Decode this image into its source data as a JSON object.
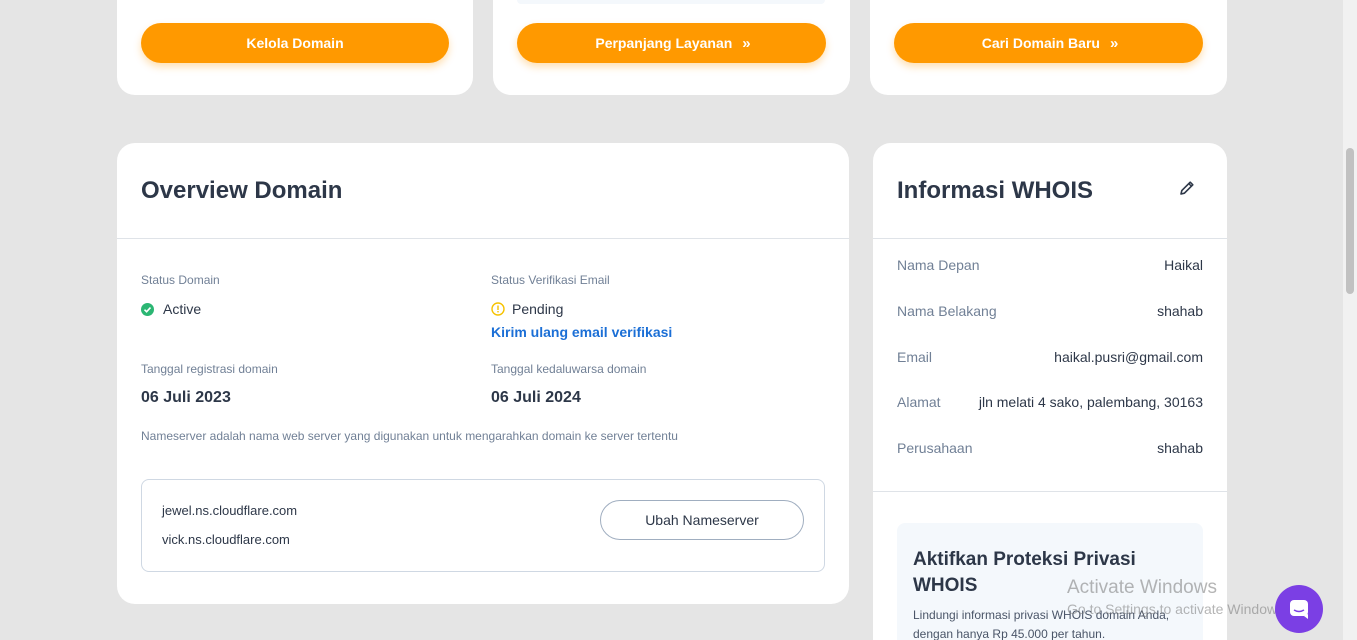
{
  "top_cards": {
    "manage_domain": "Kelola Domain",
    "renew_service": "Perpanjang Layanan",
    "find_domain": "Cari Domain Baru",
    "chevron_glyph": "»"
  },
  "overview": {
    "title": "Overview Domain",
    "status_domain_label": "Status Domain",
    "status_domain_value": "Active",
    "status_email_label": "Status Verifikasi Email",
    "status_email_value": "Pending",
    "resend_link": "Kirim ulang email verifikasi",
    "reg_date_label": "Tanggal registrasi domain",
    "reg_date_value": "06 Juli 2023",
    "exp_date_label": "Tanggal kedaluwarsa domain",
    "exp_date_value": "06 Juli 2024",
    "ns_description": "Nameserver adalah nama web server yang digunakan untuk mengarahkan domain ke server tertentu",
    "nameservers": [
      "jewel.ns.cloudflare.com",
      "vick.ns.cloudflare.com"
    ],
    "change_ns_button": "Ubah Nameserver",
    "colors": {
      "active": "#2bb673",
      "pending": "#f6c200",
      "link": "#1b6fd6"
    }
  },
  "whois": {
    "title": "Informasi WHOIS",
    "rows": [
      {
        "key": "Nama Depan",
        "value": "Haikal"
      },
      {
        "key": "Nama Belakang",
        "value": "shahab"
      },
      {
        "key": "Email",
        "value": "haikal.pusri@gmail.com"
      },
      {
        "key": "Alamat",
        "value": "jln melati 4 sako, palembang, 30163"
      },
      {
        "key": "Perusahaan",
        "value": "shahab"
      }
    ],
    "privacy_title_1": "Aktifkan Proteksi Privasi",
    "privacy_title_2": "WHOIS",
    "privacy_desc_1": "Lindungi informasi privasi WHOIS domain Anda,",
    "privacy_desc_2": "dengan hanya Rp 45.000 per tahun."
  },
  "watermark": {
    "line1": "Activate Windows",
    "line2": "Go to Settings to activate Windows."
  },
  "accent": "#ff9900",
  "icons": [
    "chevron-double-right-icon",
    "check-circle-icon",
    "info-circle-icon",
    "pencil-icon",
    "chat-icon"
  ]
}
